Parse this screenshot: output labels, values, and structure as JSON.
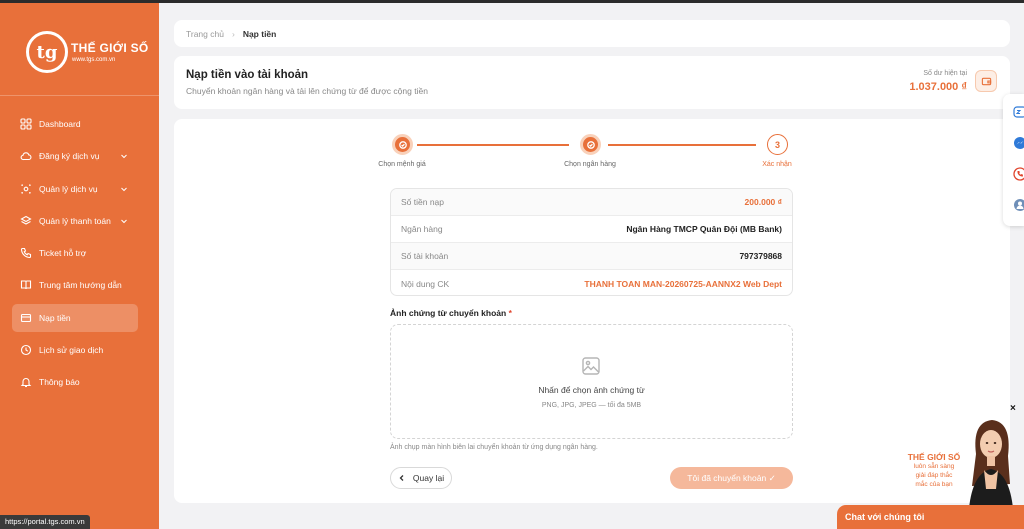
{
  "brand": {
    "logo_mark": "tg",
    "name": "THẾ GIỚI SỐ",
    "website": "www.tgs.com.vn",
    "accent_color": "#e8703a"
  },
  "sidebar": {
    "items": [
      {
        "label": "Dashboard",
        "icon": "grid-icon",
        "has_submenu": false,
        "active": false
      },
      {
        "label": "Đăng ký dịch vụ",
        "icon": "cloud-icon",
        "has_submenu": true,
        "active": false
      },
      {
        "label": "Quản lý dịch vụ",
        "icon": "settings-icon",
        "has_submenu": true,
        "active": false
      },
      {
        "label": "Quản lý thanh toán",
        "icon": "layers-icon",
        "has_submenu": true,
        "active": false
      },
      {
        "label": "Ticket hỗ trợ",
        "icon": "phone-icon",
        "has_submenu": false,
        "active": false
      },
      {
        "label": "Trung tâm hướng dẫn",
        "icon": "book-icon",
        "has_submenu": false,
        "active": false
      },
      {
        "label": "Nạp tiền",
        "icon": "wallet-icon",
        "has_submenu": false,
        "active": true
      },
      {
        "label": "Lịch sử giao dịch",
        "icon": "history-icon",
        "has_submenu": false,
        "active": false
      },
      {
        "label": "Thông báo",
        "icon": "bell-icon",
        "has_submenu": false,
        "active": false
      }
    ]
  },
  "status_url": "https://portal.tgs.com.vn",
  "breadcrumb": {
    "home": "Trang chủ",
    "current": "Nạp tiền"
  },
  "header": {
    "title": "Nạp tiền vào tài khoản",
    "subtitle": "Chuyển khoản ngân hàng và tải lên chứng từ để được cộng tiền",
    "balance_label": "Số dư hiện tại",
    "balance_value": "1.037.000 ₫"
  },
  "stepper": {
    "steps": [
      {
        "label": "Chọn mệnh giá",
        "state": "done",
        "number": "1"
      },
      {
        "label": "Chọn ngân hàng",
        "state": "done",
        "number": "2"
      },
      {
        "label": "Xác nhận",
        "state": "current",
        "number": "3"
      }
    ]
  },
  "summary": {
    "rows": [
      {
        "label": "Số tiền nạp",
        "value": "200.000 ₫",
        "accent": true
      },
      {
        "label": "Ngân hàng",
        "value": "Ngân Hàng TMCP Quân Đội (MB Bank)",
        "accent": false
      },
      {
        "label": "Số tài khoản",
        "value": "797379868",
        "accent": false
      },
      {
        "label": "Nội dung CK",
        "value": "THANH TOAN MAN-20260725-AANNX2 Web Dept",
        "accent": true
      }
    ]
  },
  "upload": {
    "label": "Ảnh chứng từ chuyển khoản",
    "required_mark": "*",
    "prompt": "Nhấn để chọn ảnh chứng từ",
    "hint": "PNG, JPG, JPEG — tối đa 5MB",
    "note": "Ảnh chụp màn hình biên lai chuyển khoản từ ứng dụng ngân hàng."
  },
  "actions": {
    "back_label": "Quay lại",
    "confirm_label": "Tôi đã chuyển khoản ✓"
  },
  "chat_widget": {
    "close_label": "×",
    "promo_title": "THẾ GIỚI SỐ",
    "promo_lines": [
      "luôn sẵn sàng",
      "giải đáp thắc",
      "mắc của bạn"
    ],
    "button_label": "Chat với chúng tôi"
  },
  "floating_contacts": [
    "zalo-icon",
    "messenger-icon",
    "hotline-icon",
    "support-agent-icon"
  ]
}
